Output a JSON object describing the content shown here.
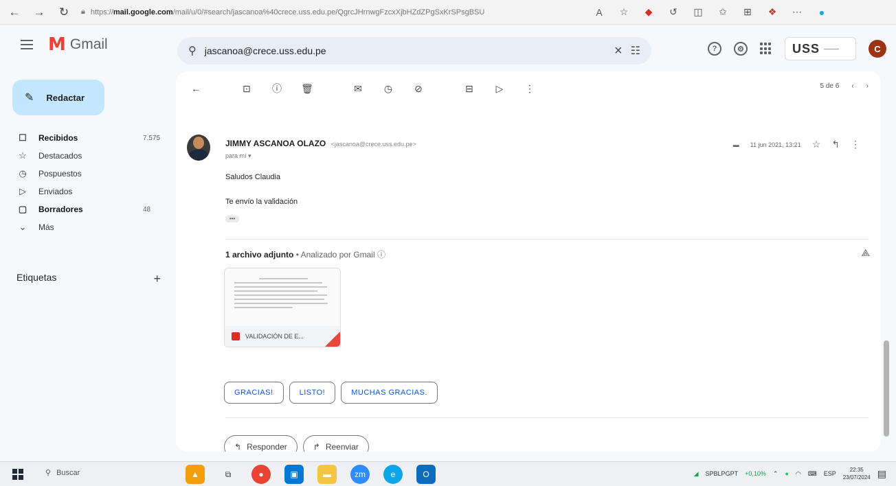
{
  "browser": {
    "url_prefix": "https://",
    "url_host": "mail.google.com",
    "url_path": "/mail/u/0/#search/jascanoa%40crece.uss.edu.pe/QgrcJHrnwgFzcxXjbHZdZPgSxKrSPsgBSU"
  },
  "header": {
    "app_name": "Gmail",
    "search_query": "jascanoa@crece.uss.edu.pe",
    "org": "USS",
    "avatar_letter": "C"
  },
  "sidebar": {
    "compose_label": "Redactar",
    "items": [
      {
        "icon": "inbox-icon",
        "glyph": "☐",
        "label": "Recibidos",
        "count": "7.575",
        "bold": true
      },
      {
        "icon": "star-icon",
        "glyph": "☆",
        "label": "Destacados",
        "count": "",
        "bold": false
      },
      {
        "icon": "clock-icon",
        "glyph": "◷",
        "label": "Pospuestos",
        "count": "",
        "bold": false
      },
      {
        "icon": "send-icon",
        "glyph": "▷",
        "label": "Enviados",
        "count": "",
        "bold": false
      },
      {
        "icon": "draft-icon",
        "glyph": "▢",
        "label": "Borradores",
        "count": "48",
        "bold": true
      },
      {
        "icon": "chevron-down-icon",
        "glyph": "⌄",
        "label": "Más",
        "count": "",
        "bold": false
      }
    ],
    "labels_title": "Etiquetas",
    "labels_add": "+"
  },
  "toolbar": {
    "pager": "5 de 6"
  },
  "message": {
    "sender_name": "JIMMY ASCANOA OLAZO",
    "sender_email": "<jascanoa@crece.uss.edu.pe>",
    "to": "para mí ▾",
    "date": "11 jun 2021, 13:21",
    "greeting": "Saludos Claudia",
    "body": "Te envío la validación",
    "ellipsis": "•••"
  },
  "attachment": {
    "count_label": "1 archivo adjunto",
    "scan_label": " • Analizado por Gmail ⓘ",
    "file_name": "VALIDACIÓN DE E..."
  },
  "smart_replies": [
    "GRACIAS!",
    "LISTO!",
    "MUCHAS GRACIAS."
  ],
  "actions": {
    "reply": "Responder",
    "forward": "Reenviar"
  },
  "taskbar": {
    "search_placeholder": "Buscar",
    "stock_name": "SPBLPGPT",
    "stock_change": "+0,10%",
    "language": "ESP",
    "time": "22:35",
    "date": "23/07/2024"
  }
}
